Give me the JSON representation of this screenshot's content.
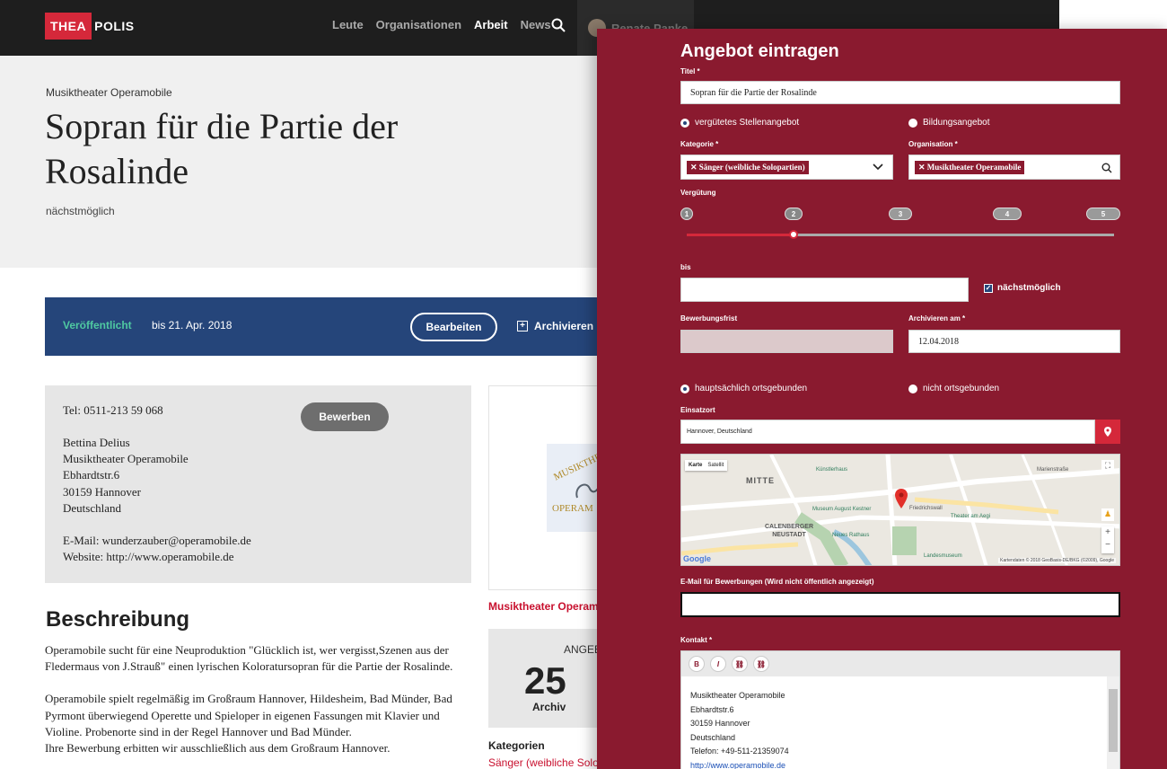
{
  "nav": {
    "logo_mark": "THEA",
    "logo_rest": "POLIS",
    "links": [
      "Leute",
      "Organisationen",
      "Arbeit",
      "News"
    ],
    "active": "Arbeit",
    "user": "Renate Panke"
  },
  "hero": {
    "org": "Musiktheater Operamobile",
    "title": "Sopran für die Partie der Rosalinde",
    "date": "nächstmöglich"
  },
  "status": {
    "published": "Veröffentlicht",
    "until": "bis 21. Apr. 2018",
    "edit": "Bearbeiten",
    "archive": "Archivieren"
  },
  "contact": {
    "tel": "Tel: 0511-213 59 068",
    "apply": "Bewerben",
    "name": "Bettina Delius",
    "org": "Musiktheater Operamobile",
    "street": "Ebhardtstr.6",
    "city": "30159 Hannover",
    "country": "Deutschland",
    "email": "E-Mail: wunderzauber@operamobile.de",
    "website": "Website: http://www.operamobile.de"
  },
  "side": {
    "logo_text_top": "MUSIKTHE",
    "logo_text_bottom": "OPERAM",
    "org_link": "Musiktheater Operam",
    "stats_label": "ANGEB",
    "stats_num": "25",
    "stats_sub": "Archiv",
    "cat_heading": "Kategorien",
    "cat_value": "Sänger (weibliche Solo"
  },
  "description": {
    "heading": "Beschreibung",
    "p1": "Operamobile sucht für eine Neuproduktion \"Glücklich ist, wer vergisst,Szenen aus der Fledermaus von J.Strauß\" einen lyrischen Koloratursopran für die Partie der Rosalinde.",
    "p2": "Operamobile spielt regelmäßig im Großraum Hannover, Hildesheim, Bad Münder, Bad Pyrmont überwiegend Operette und Spieloper in eigenen Fassungen mit Klavier und Violine. Probenorte sind in der Regel Hannover und Bad Münder.",
    "p3": "Ihre Bewerbung erbitten wir ausschließlich aus dem Großraum Hannover."
  },
  "form": {
    "heading": "Angebot eintragen",
    "title_label": "Titel *",
    "title_value": "Sopran für die Partie der Rosalinde",
    "type_paid": "vergütetes Stellenangebot",
    "type_edu": "Bildungsangebot",
    "cat_label": "Kategorie *",
    "cat_value": "Sänger (weibliche Solopartien)",
    "org_label": "Organisation *",
    "org_value": "Musiktheater Operamobile",
    "pay_label": "Vergütung",
    "pay_steps": [
      "1",
      "2",
      "3",
      "4",
      "5"
    ],
    "pay_selected": 2,
    "bis_label": "bis",
    "bis_value": "",
    "asap": "nächstmöglich",
    "deadline_label": "Bewerbungsfrist",
    "archive_label": "Archivieren am *",
    "archive_value": "12.04.2018",
    "loc_main": "hauptsächlich ortsgebunden",
    "loc_none": "nicht ortsgebunden",
    "place_label": "Einsatzort",
    "place_value": "Hannover, Deutschland",
    "map": {
      "tab_map": "Karte",
      "tab_sat": "Satellit",
      "labels": [
        "Mitte",
        "Calenberger Neustadt",
        "Museum August Kestner",
        "Neues Rathaus",
        "Theater am Aegi",
        "Friedrichswall",
        "Landesmuseum",
        "Künstlerhaus",
        "Marienstraße"
      ],
      "google": "Google",
      "footer": "Kartendaten © 2018 GeoBasis-DE/BKG (©2009), Google"
    },
    "email_label": "E-Mail für Bewerbungen (Wird nicht öffentlich angezeigt)",
    "email_value": "",
    "contact_label": "Kontakt *",
    "toolbar": [
      "B",
      "I",
      "link",
      "unlink"
    ],
    "contact_lines": [
      "Musiktheater Operamobile",
      "Ebhardtstr.6",
      "30159 Hannover",
      "Deutschland",
      "Telefon: +49-511-21359074"
    ],
    "contact_link": "http://www.operamobile.de"
  },
  "colors": {
    "brand": "#d5283a",
    "overlay": "#8a1a2f",
    "bar": "#25457a",
    "published": "#4fc9a1"
  }
}
